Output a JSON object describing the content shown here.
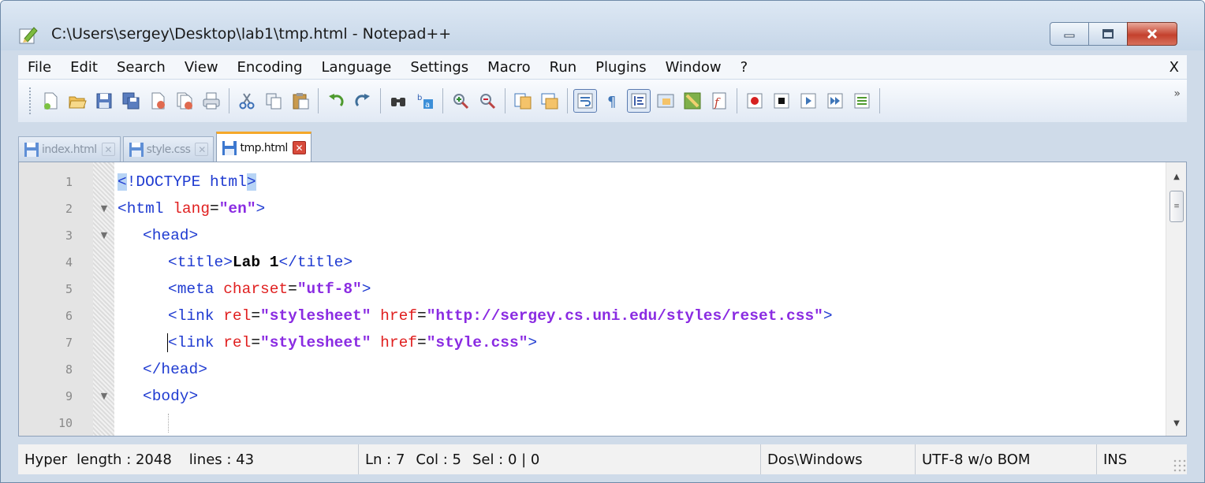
{
  "window": {
    "title": "C:\\Users\\sergey\\Desktop\\lab1\\tmp.html - Notepad++",
    "buttons": {
      "minimize": "minimize-icon",
      "maximize": "maximize-icon",
      "close": "close-icon"
    }
  },
  "menu": {
    "items": [
      "File",
      "Edit",
      "Search",
      "View",
      "Encoding",
      "Language",
      "Settings",
      "Macro",
      "Run",
      "Plugins",
      "Window",
      "?"
    ],
    "close_label": "X"
  },
  "toolbar": {
    "icons": [
      "new-file-icon",
      "open-file-icon",
      "save-icon",
      "save-all-icon",
      "close-icon",
      "close-all-icon",
      "print-icon",
      "cut-icon",
      "copy-icon",
      "paste-icon",
      "undo-icon",
      "redo-icon",
      "find-icon",
      "replace-icon",
      "zoom-in-icon",
      "zoom-out-icon",
      "sync-vertical-icon",
      "sync-horizontal-icon",
      "word-wrap-icon",
      "show-all-chars-icon",
      "indent-guide-icon",
      "user-language-icon",
      "document-map-icon",
      "function-list-icon",
      "record-macro-icon",
      "stop-macro-icon",
      "play-macro-icon",
      "run-macro-multiple-icon",
      "save-macro-icon"
    ],
    "more_label": "»"
  },
  "tabs": [
    {
      "label": "index.html",
      "active": false
    },
    {
      "label": "style.css",
      "active": false
    },
    {
      "label": "tmp.html",
      "active": true
    }
  ],
  "editor": {
    "line_numbers": [
      "1",
      "2",
      "3",
      "4",
      "5",
      "6",
      "7",
      "8",
      "9",
      "10"
    ],
    "lines": {
      "l1": {
        "open": "<",
        "doctype": "!DOCTYPE html",
        "close": ">"
      },
      "l2": {
        "tag": "<html",
        "attr": "lang",
        "eq": "=",
        "val": "\"en\"",
        "end": ">"
      },
      "l3": {
        "tag": "<head>"
      },
      "l4": {
        "tag_open": "<title>",
        "text": "Lab 1",
        "tag_close": "</title>"
      },
      "l5": {
        "tag": "<meta",
        "attr": "charset",
        "eq": "=",
        "val": "\"utf-8\"",
        "end": ">"
      },
      "l6": {
        "tag": "<link",
        "attr1": "rel",
        "eq1": "=",
        "val1": "\"stylesheet\"",
        "attr2": "href",
        "eq2": "=",
        "val2": "\"http://sergey.cs.uni.edu/styles/reset.css\"",
        "end": ">"
      },
      "l7": {
        "tag": "<link",
        "attr1": "rel",
        "eq1": "=",
        "val1": "\"stylesheet\"",
        "attr2": "href",
        "eq2": "=",
        "val2": "\"style.css\"",
        "end": ">"
      },
      "l8": {
        "tag": "</head>"
      },
      "l9": {
        "tag": "<body>"
      }
    }
  },
  "status": {
    "doc_type": "Hyper",
    "length": "length : 2048",
    "lines": "lines : 43",
    "ln": "Ln : 7",
    "col": "Col : 5",
    "sel": "Sel : 0 | 0",
    "eol": "Dos\\Windows",
    "encoding": "UTF-8 w/o BOM",
    "mode": "INS"
  }
}
